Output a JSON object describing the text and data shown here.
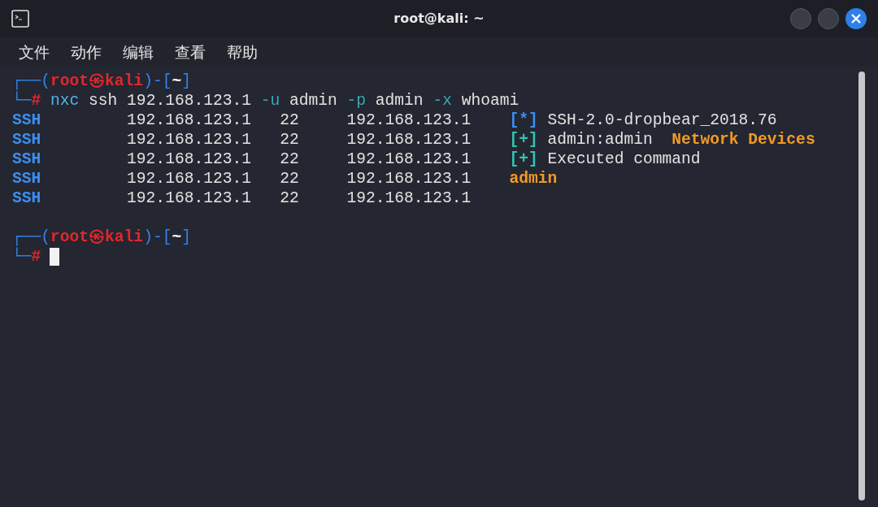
{
  "window": {
    "title": "root@kali: ~"
  },
  "menu": [
    "文件",
    "动作",
    "编辑",
    "查看",
    "帮助"
  ],
  "terminal": [
    {
      "kind": "prompt",
      "segments": [
        {
          "kind": "frame",
          "text": "┌──("
        },
        {
          "kind": "user",
          "text": "root㉿kali"
        },
        {
          "kind": "frame",
          "text": ")-["
        },
        {
          "kind": "path",
          "text": "~"
        },
        {
          "kind": "frame",
          "text": "]"
        }
      ]
    },
    {
      "kind": "prompt",
      "segments": [
        {
          "kind": "frame",
          "text": "└─"
        },
        {
          "kind": "hash",
          "text": "#"
        }
      ],
      "command": [
        {
          "kind": "command",
          "text": "nxc"
        },
        {
          "kind": "arg",
          "text": "ssh"
        },
        {
          "kind": "arg",
          "text": "192.168.123.1"
        },
        {
          "kind": "flag",
          "text": "-u"
        },
        {
          "kind": "arg",
          "text": "admin"
        },
        {
          "kind": "flag",
          "text": "-p"
        },
        {
          "kind": "arg",
          "text": "admin"
        },
        {
          "kind": "flag",
          "text": "-x"
        },
        {
          "kind": "arg",
          "text": "whoami"
        }
      ]
    },
    {
      "kind": "output",
      "cells": [
        "SSH",
        "192.168.123.1",
        "22",
        "192.168.123.1"
      ],
      "message": [
        {
          "kind": "info",
          "text": "[*]"
        },
        {
          "kind": "text",
          "text": "SSH-2.0-dropbear_2018.76"
        }
      ]
    },
    {
      "kind": "output",
      "cells": [
        "SSH",
        "192.168.123.1",
        "22",
        "192.168.123.1"
      ],
      "message": [
        {
          "kind": "ok",
          "text": "[+]"
        },
        {
          "kind": "text",
          "text": "admin:admin"
        },
        {
          "kind": "highlight",
          "text": "Network Devices"
        }
      ]
    },
    {
      "kind": "output",
      "cells": [
        "SSH",
        "192.168.123.1",
        "22",
        "192.168.123.1"
      ],
      "message": [
        {
          "kind": "ok",
          "text": "[+]"
        },
        {
          "kind": "text",
          "text": "Executed command"
        }
      ]
    },
    {
      "kind": "output",
      "cells": [
        "SSH",
        "192.168.123.1",
        "22",
        "192.168.123.1"
      ],
      "message": [
        {
          "kind": "highlight",
          "text": "admin"
        }
      ]
    },
    {
      "kind": "output",
      "cells": [
        "SSH",
        "192.168.123.1",
        "22",
        "192.168.123.1"
      ]
    },
    {
      "kind": "blank"
    },
    {
      "kind": "prompt",
      "segments": [
        {
          "kind": "frame",
          "text": "┌──("
        },
        {
          "kind": "user",
          "text": "root㉿kali"
        },
        {
          "kind": "frame",
          "text": ")-["
        },
        {
          "kind": "path",
          "text": "~"
        },
        {
          "kind": "frame",
          "text": "]"
        }
      ]
    },
    {
      "kind": "prompt",
      "cursor": true,
      "segments": [
        {
          "kind": "frame",
          "text": "└─"
        },
        {
          "kind": "hash",
          "text": "#"
        }
      ]
    }
  ]
}
